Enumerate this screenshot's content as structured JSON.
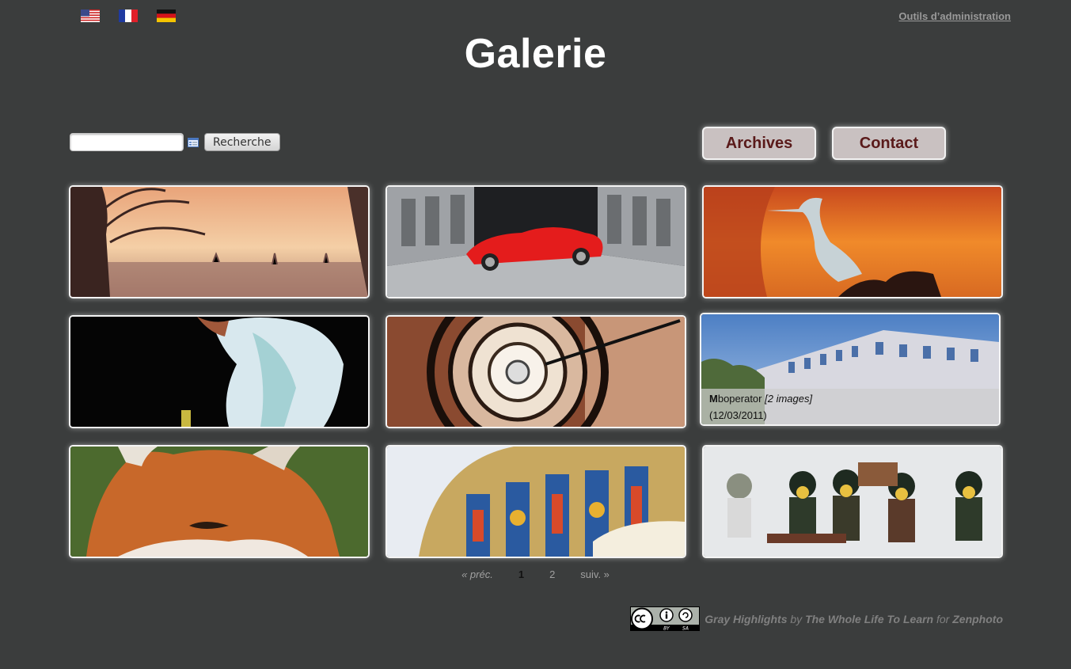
{
  "languages": [
    {
      "name": "english-flag-icon"
    },
    {
      "name": "french-flag-icon"
    },
    {
      "name": "german-flag-icon"
    }
  ],
  "header": {
    "admin_link": "Outils d’administration",
    "title": "Galerie"
  },
  "search": {
    "value": "",
    "options_icon": "search-options-icon",
    "button_label": "Recherche"
  },
  "nav": {
    "archives": "Archives",
    "contact": "Contact"
  },
  "album_caption": {
    "initial": "M",
    "title_rest": "boperator",
    "count": "[2 images]",
    "date": "(12/03/2011)"
  },
  "albums": [
    {
      "thumb": "misty-sunset-city-thumbnail"
    },
    {
      "thumb": "red-sports-car-thumbnail"
    },
    {
      "thumb": "heron-sunset-thumbnail"
    },
    {
      "thumb": "musician-dark-stage-thumbnail"
    },
    {
      "thumb": "spiral-staircase-thumbnail"
    },
    {
      "thumb": "office-building-thumbnail"
    },
    {
      "thumb": "red-fox-thumbnail"
    },
    {
      "thumb": "stained-glass-theatre-thumbnail"
    },
    {
      "thumb": "lego-soldiers-thumbnail"
    }
  ],
  "pagination": {
    "prev": "« préc.",
    "pages": [
      "1",
      "2"
    ],
    "current": "1",
    "next": "suiv. »"
  },
  "footer": {
    "license_badge": "cc-by-sa-badge",
    "theme": "Gray Highlights",
    "by_word": "by",
    "author": "The Whole Life To Learn",
    "for_word": "for",
    "platform": "Zenphoto"
  },
  "colors": {
    "background": "#3b3d3d",
    "nav_button_bg": "#c9c1c1",
    "nav_button_text": "#5a1a1a"
  }
}
